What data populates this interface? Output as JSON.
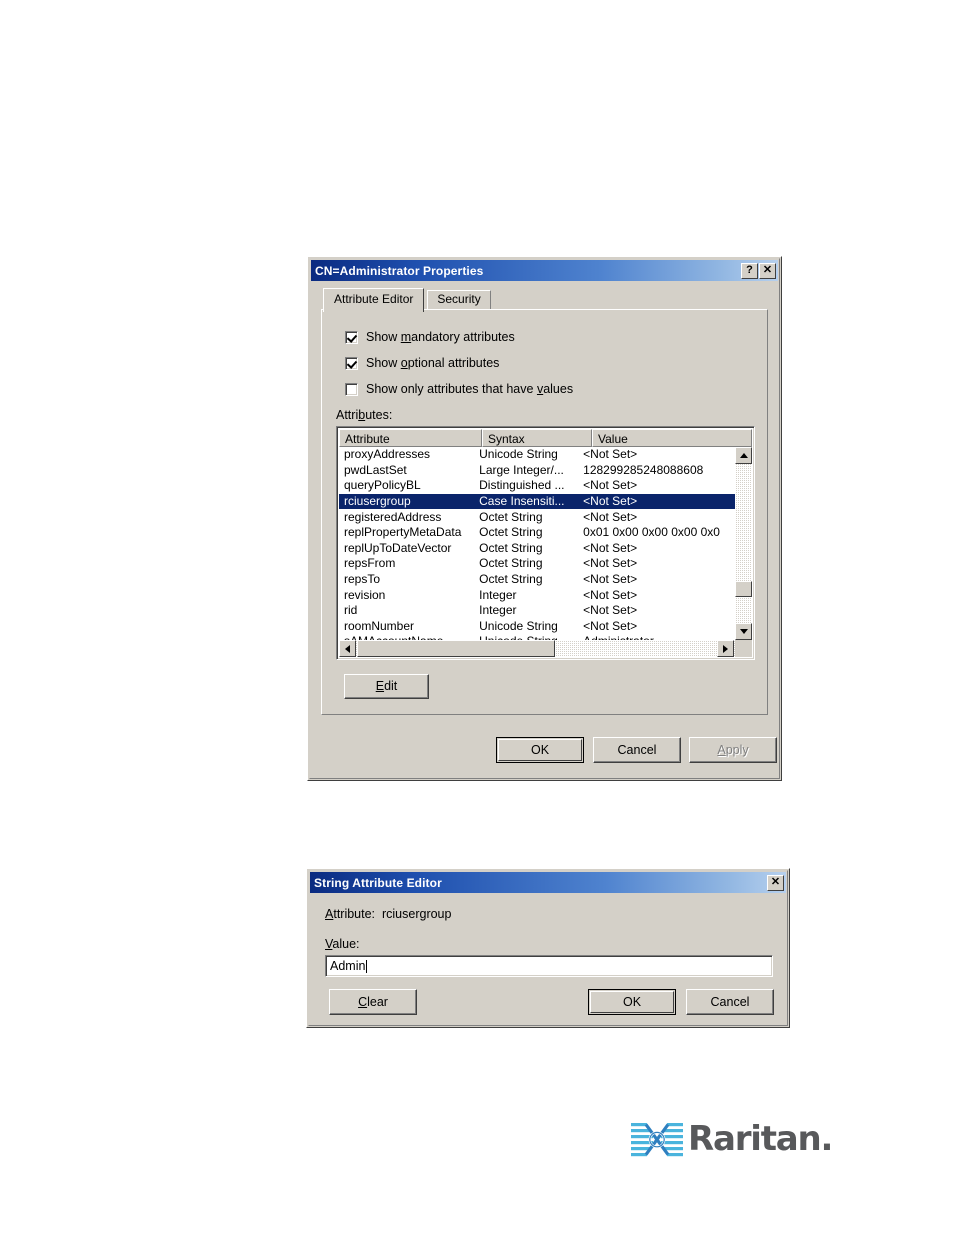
{
  "properties_dialog": {
    "title": "CN=Administrator Properties",
    "titlebar_buttons": [
      {
        "name": "help",
        "glyph": "?"
      },
      {
        "name": "close",
        "glyph": "✕"
      }
    ],
    "tabs": [
      {
        "label": "Attribute Editor",
        "active": true
      },
      {
        "label": "Security",
        "active": false
      }
    ],
    "checkboxes": [
      {
        "pre": "Show ",
        "mn": "m",
        "post": "andatory attributes",
        "checked": true
      },
      {
        "pre": "Show ",
        "mn": "o",
        "post": "ptional attributes",
        "checked": true
      },
      {
        "pre": "Show only attributes that have ",
        "mn": "v",
        "post": "alues",
        "checked": false
      }
    ],
    "attributes_label": {
      "pre": "Attri",
      "mn": "b",
      "post": "utes:"
    },
    "columns": [
      "Attribute",
      "Syntax",
      "Value"
    ],
    "rows": [
      {
        "attribute": "proxyAddresses",
        "syntax": "Unicode String",
        "value": "<Not Set>",
        "selected": false
      },
      {
        "attribute": "pwdLastSet",
        "syntax": "Large Integer/...",
        "value": "128299285248088608",
        "selected": false
      },
      {
        "attribute": "queryPolicyBL",
        "syntax": "Distinguished ...",
        "value": "<Not Set>",
        "selected": false
      },
      {
        "attribute": "rciusergroup",
        "syntax": "Case Insensiti...",
        "value": "<Not Set>",
        "selected": true
      },
      {
        "attribute": "registeredAddress",
        "syntax": "Octet String",
        "value": "<Not Set>",
        "selected": false
      },
      {
        "attribute": "replPropertyMetaData",
        "syntax": "Octet String",
        "value": "0x01 0x00 0x00 0x00 0x0",
        "selected": false
      },
      {
        "attribute": "replUpToDateVector",
        "syntax": "Octet String",
        "value": "<Not Set>",
        "selected": false
      },
      {
        "attribute": "repsFrom",
        "syntax": "Octet String",
        "value": "<Not Set>",
        "selected": false
      },
      {
        "attribute": "repsTo",
        "syntax": "Octet String",
        "value": "<Not Set>",
        "selected": false
      },
      {
        "attribute": "revision",
        "syntax": "Integer",
        "value": "<Not Set>",
        "selected": false
      },
      {
        "attribute": "rid",
        "syntax": "Integer",
        "value": "<Not Set>",
        "selected": false
      },
      {
        "attribute": "roomNumber",
        "syntax": "Unicode String",
        "value": "<Not Set>",
        "selected": false
      },
      {
        "attribute": "sAMAccountName",
        "syntax": "Unicode String",
        "value": "Administrator",
        "selected": false
      }
    ],
    "edit_button": {
      "pre": "E",
      "mn": "",
      "post": "dit",
      "mnemonic": "E"
    },
    "footer_buttons": [
      {
        "label": "OK",
        "style": "default",
        "disabled": false
      },
      {
        "label": "Cancel",
        "style": "normal",
        "disabled": false
      },
      {
        "label": "Apply",
        "style": "normal",
        "disabled": true,
        "mn": "A",
        "rest": "pply"
      }
    ]
  },
  "string_editor_dialog": {
    "title": "String Attribute Editor",
    "close_glyph": "✕",
    "attribute_label": {
      "mn": "A",
      "post": "ttribute:"
    },
    "attribute_name": "rciusergroup",
    "value_label": {
      "mn": "V",
      "post": "alue:"
    },
    "value_text": "Admin",
    "buttons": [
      {
        "label": "Clear",
        "mn": "C",
        "rest": "lear",
        "style": "normal"
      },
      {
        "label": "OK",
        "style": "default"
      },
      {
        "label": "Cancel",
        "style": "normal"
      }
    ]
  },
  "branding": {
    "wordmark": "Raritan.",
    "mark_color": "#4ab4dd",
    "word_color": "#58595b"
  },
  "colors": {
    "dialog_face": "#d4d0c8",
    "titlebar_start": "#0a2a80",
    "titlebar_end": "#b6d0ee",
    "selection": "#0a246a",
    "page_background": "#ffffff"
  }
}
